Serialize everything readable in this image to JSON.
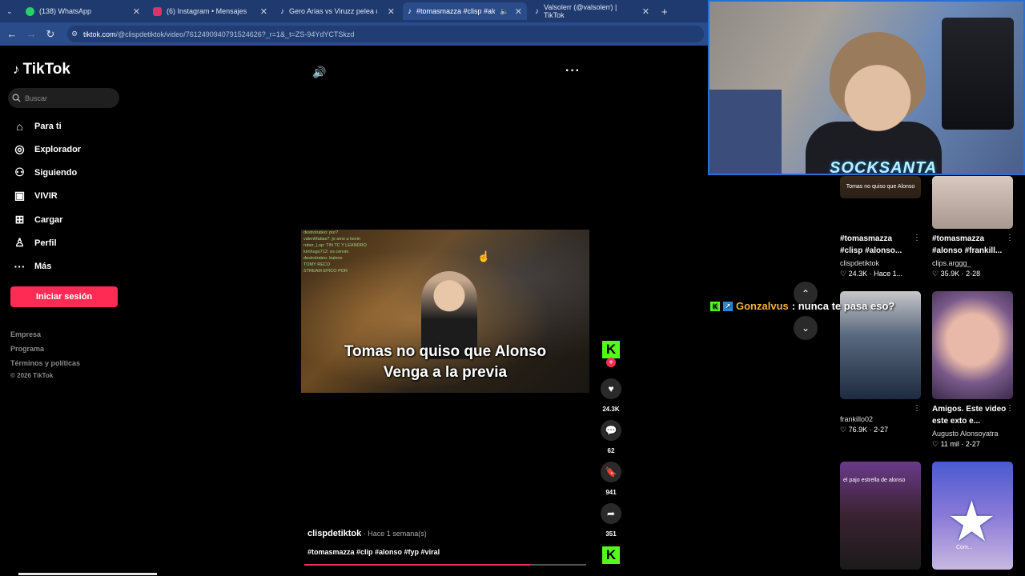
{
  "browser": {
    "tabs": [
      {
        "label": "(138) WhatsApp",
        "icon": "whatsapp-icon",
        "color": "#25d366"
      },
      {
        "label": "(6) Instagram • Mensajes",
        "icon": "instagram-icon",
        "color": "#e1306c"
      },
      {
        "label": "Gero Arias vs Viruzz pelea de la",
        "icon": "tiktok-icon",
        "color": "#000000"
      },
      {
        "label": "#tomasmazza #clisp #alonso",
        "icon": "tiktok-icon",
        "color": "#000000"
      },
      {
        "label": "Valsolerr (@valsolerr) | TikTok",
        "icon": "tiktok-icon",
        "color": "#000000"
      }
    ],
    "new_tab": "+",
    "url_host": "tiktok.com",
    "url_path": "/@clispdetiktok/video/7612490940791524626?_r=1&_t=ZS-94YdYCTSkzd"
  },
  "sidebar": {
    "logo": "TikTok",
    "search_placeholder": "Buscar",
    "items": [
      {
        "label": "Para ti",
        "icon": "home-icon"
      },
      {
        "label": "Explorador",
        "icon": "compass-icon"
      },
      {
        "label": "Siguiendo",
        "icon": "following-icon"
      },
      {
        "label": "VIVIR",
        "icon": "live-tv-icon"
      },
      {
        "label": "Cargar",
        "icon": "upload-icon"
      },
      {
        "label": "Perfil",
        "icon": "profile-icon"
      },
      {
        "label": "Más",
        "icon": "more-dots-icon"
      }
    ],
    "login": "Iniciar sesión",
    "footer": [
      "Empresa",
      "Programa",
      "Términos y políticas",
      "© 2026 TikTok"
    ]
  },
  "video": {
    "caption_line1": "Tomas no quiso que Alonso",
    "caption_line2": "Venga a la previa",
    "chat_lines": [
      "destrolrateo: por?",
      "valenMatias7: jo amo a kevin",
      "rober_Lop: TIN TC Y LEANDRO",
      "kimhugo712: es cenvio",
      "destrolrateo: baleno",
      "TOMY RECO",
      "STREAM EPICO POR"
    ],
    "progress": 0.8
  },
  "actions": {
    "likes": "24.3K",
    "comments": "62",
    "saves": "941",
    "shares": "351"
  },
  "post": {
    "author": "clispdetiktok",
    "time": " · Hace 1 semana(s)",
    "tags": "#tomasmazza #clip #alonso #fyp #viral"
  },
  "webcam": {
    "overlay_text": "SOCKSANTA",
    "thumb_caption": "Tomas no quiso que Alonso"
  },
  "chat_overlay": {
    "username": "Gonzalvus",
    "message": ": nunca te pasa eso?"
  },
  "feed": [
    {
      "title": "#tomasmazza #clisp #alonso...",
      "author": "clispdetiktok",
      "stats": "24.3K · Hace 1..."
    },
    {
      "title": "#tomasmazza #alonso #frankill...",
      "author": "clips.arggg_",
      "stats": "35.9K · 2-28"
    },
    {
      "title": "",
      "author": "frankillo02",
      "stats": "76.9K · 2-27"
    },
    {
      "title": "Amigos. Este video este exto e...",
      "author": "Augusto Alonsoyatra",
      "stats": "11 mil · 2-27"
    },
    {
      "title": "",
      "author": "",
      "stats": "",
      "overlay": "el pajo estrella de alonso"
    },
    {
      "title": "",
      "author": "",
      "stats": "",
      "overlay": "Com..."
    }
  ]
}
